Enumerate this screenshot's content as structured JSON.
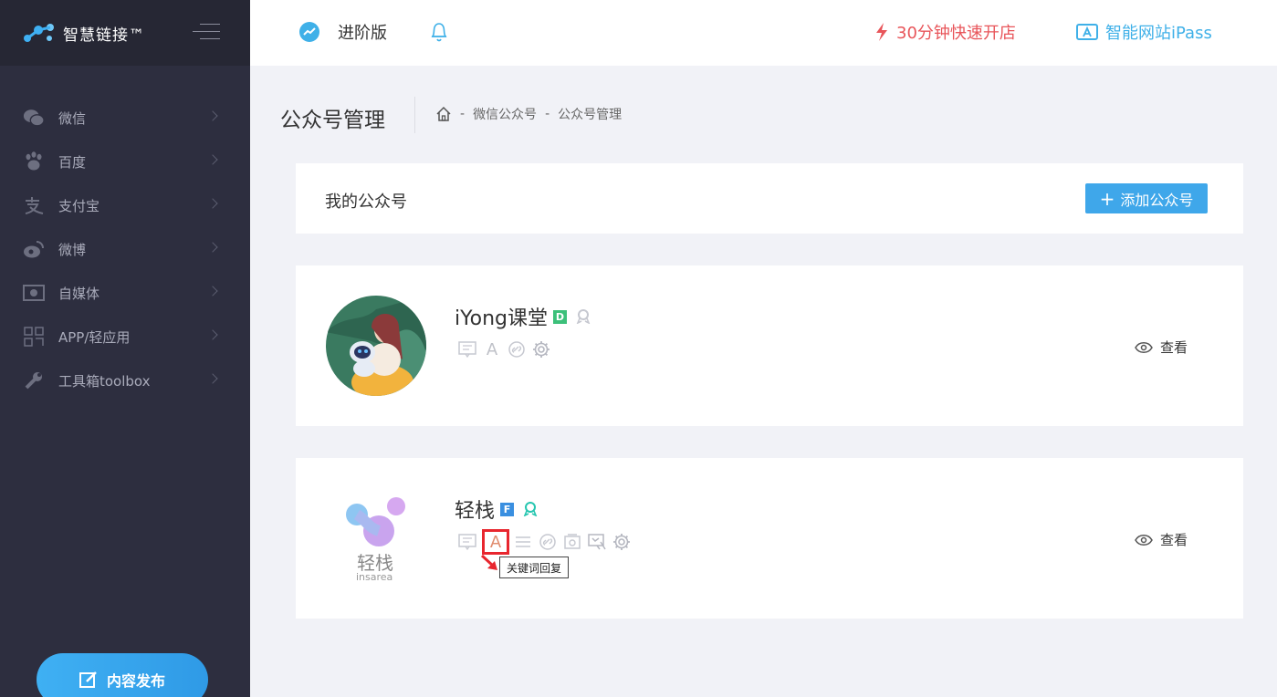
{
  "app": {
    "name": "智慧链接™"
  },
  "sidebar": {
    "items": [
      {
        "label": "微信",
        "icon": "wechat-icon"
      },
      {
        "label": "百度",
        "icon": "baidu-paw-icon"
      },
      {
        "label": "支付宝",
        "icon": "alipay-icon"
      },
      {
        "label": "微博",
        "icon": "weibo-icon"
      },
      {
        "label": "自媒体",
        "icon": "media-icon"
      },
      {
        "label": "APP/轻应用",
        "icon": "app-grid-icon"
      },
      {
        "label": "工具箱toolbox",
        "icon": "wrench-icon"
      }
    ],
    "publish_label": "内容发布"
  },
  "header": {
    "version_label": "进阶版",
    "store_label": "30分钟快速开店",
    "ipass_label": "智能网站iPass"
  },
  "page": {
    "title": "公众号管理",
    "breadcrumb": [
      "微信公众号",
      "公众号管理"
    ],
    "breadcrumb_sep": "-"
  },
  "accounts_panel": {
    "title": "我的公众号",
    "add_label": "添加公众号"
  },
  "accounts": [
    {
      "name": "iYong课堂",
      "badge": "D",
      "view_label": "查看"
    },
    {
      "name": "轻栈",
      "badge": "F",
      "view_label": "查看",
      "logo_text": "轻栈",
      "logo_sub": "insarea"
    }
  ],
  "tooltip": "关键词回复",
  "colors": {
    "sidebar_bg": "#2d2e3f",
    "accent_blue": "#3fa7ea",
    "store_red": "#e8555a",
    "ipass_blue": "#3fb0e8",
    "highlight_red": "#e8262e"
  }
}
